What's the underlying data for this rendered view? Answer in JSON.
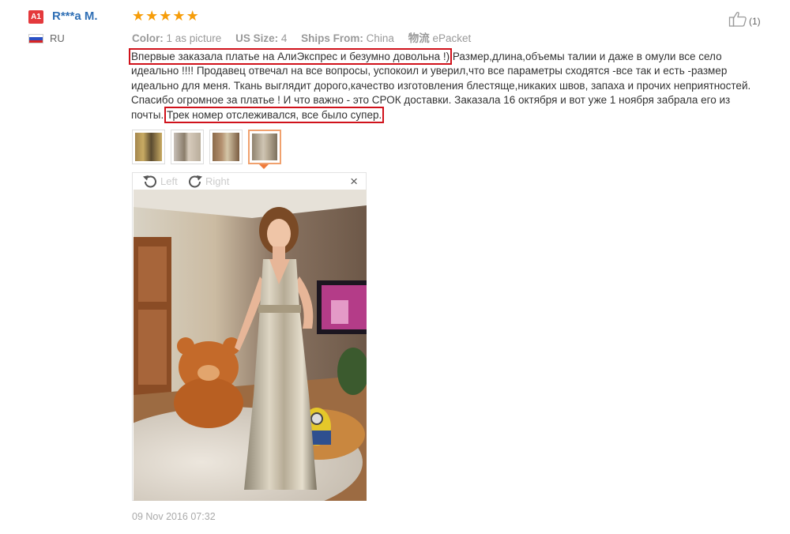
{
  "reviewer": {
    "level": "A1",
    "name": "R***a M.",
    "country": "RU",
    "flag_colors": [
      "#ffffff",
      "#2b51c5",
      "#d82424"
    ]
  },
  "rating": {
    "stars": 5,
    "color": "#f69d0a"
  },
  "attributes": [
    {
      "key": "Color:",
      "value": "1 as picture"
    },
    {
      "key": "US Size:",
      "value": "4"
    },
    {
      "key": "Ships From:",
      "value": "China"
    },
    {
      "key": "物流",
      "value": "ePacket"
    }
  ],
  "helpful": {
    "count": "(1)",
    "icon": "thumbs-up-icon"
  },
  "review": {
    "highlight_1": "Впервые заказала платье на АлиЭкспрес и безумно довольна !)",
    "body": "Размер,длина,объемы талии и даже в омули все село идеально !!!! Продавец отвечал на все вопросы, успокоил и уверил,что все параметры сходятся -все так и есть -размер идеально для меня. Ткань выглядит дорого,качество изготовления блестяще,никаких швов, запаха и прочих неприятностей. Спасибо огромное за платье ! И что важно - это СРОК доставки. Заказала 16 октября и вот уже 1 ноября забрала его из почты.",
    "highlight_2": "Трек номер отслеживался, все было супер.",
    "highlight_color": "#d0121b"
  },
  "viewer": {
    "rotate_left_label": "Left",
    "rotate_right_label": "Right",
    "close_symbol": "×"
  },
  "date": "09 Nov 2016 07:32"
}
